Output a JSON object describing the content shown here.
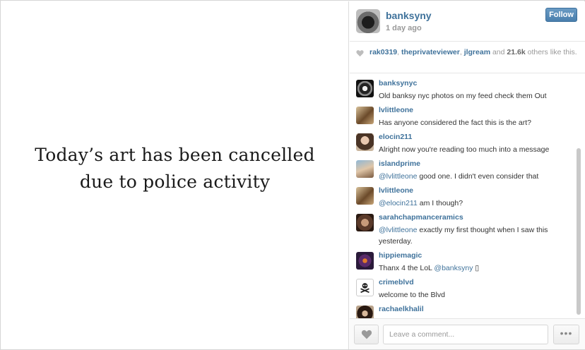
{
  "photo": {
    "caption": "Today’s art has been cancelled\ndue to police activity"
  },
  "header": {
    "username": "banksyny",
    "time_ago": "1 day ago",
    "follow_label": "Follow"
  },
  "likes": {
    "user1": "rak0319",
    "sep1": ", ",
    "user2": "theprivateviewer",
    "sep2": ", ",
    "user3": "jlgream",
    "and": " and ",
    "count": "21.6k",
    "suffix": " others like this."
  },
  "comments": [
    {
      "user": "banksynyc",
      "text": "Old banksy nyc photos on my feed check them Out"
    },
    {
      "user": "lvlittleone",
      "text": "Has anyone considered the fact this is the art?"
    },
    {
      "user": "elocin211",
      "text": "Alright now you're reading too much into a message"
    },
    {
      "user": "islandprime",
      "mention": "@lvlittleone",
      "text": " good one. I didn't even consider that"
    },
    {
      "user": "lvlittleone",
      "mention": "@elocin211",
      "text": " am I though?"
    },
    {
      "user": "sarahchapmanceramics",
      "mention": "@lvlittleone",
      "text": " exactly my first thought when I saw this yesterday."
    },
    {
      "user": "hippiemagic",
      "text_pre": "Thanx 4 the LoL ",
      "mention": "@banksyny",
      "text_post": " ▯"
    },
    {
      "user": "crimeblvd",
      "text": "welcome to the Blvd"
    },
    {
      "user": "rachaelkhalil",
      "text": ""
    }
  ],
  "footer": {
    "comment_placeholder": "Leave a comment...",
    "more_label": "•••"
  },
  "colors": {
    "link": "#3f729b",
    "muted": "#999999",
    "follow_button": "#4a7fad"
  },
  "icons": {
    "like": "heart-icon",
    "likes_row": "heart-icon",
    "more": "ellipsis-icon"
  }
}
